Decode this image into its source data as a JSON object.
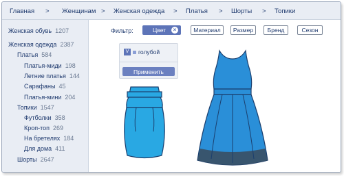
{
  "breadcrumb": {
    "items": [
      "Главная",
      "Женщинам",
      "Женская одежда",
      "Платья",
      "Шорты",
      "Топики"
    ],
    "separator": ">"
  },
  "sidebar": {
    "categories": [
      {
        "label": "Женская обувь",
        "count": "1207"
      },
      {
        "label": "Женская одежда",
        "count": "2387"
      },
      {
        "label": "Платья",
        "count": "584"
      },
      {
        "label": "Платья-миди",
        "count": "198"
      },
      {
        "label": "Летние платья",
        "count": "144"
      },
      {
        "label": "Сарафаны",
        "count": "45"
      },
      {
        "label": "Платья-мини",
        "count": "204"
      },
      {
        "label": "Топики",
        "count": "1547"
      },
      {
        "label": "Футболки",
        "count": "358"
      },
      {
        "label": "Кроп-топ",
        "count": "269"
      },
      {
        "label": "На бретелях",
        "count": "184"
      },
      {
        "label": "Для дома",
        "count": "411"
      },
      {
        "label": "Шорты",
        "count": "2647"
      }
    ]
  },
  "filter": {
    "label": "Фильтр:",
    "chips": [
      "Цвет",
      "Материал",
      "Размер",
      "Бренд",
      "Сезон"
    ],
    "active_chip": "Цвет",
    "close_glyph": "×"
  },
  "dropdown": {
    "check_glyph": "V",
    "option": "голубой",
    "apply_label": "Применить"
  },
  "products": [
    {
      "icon": "dress-icon",
      "color": "#29a8e3"
    },
    {
      "icon": "dress-icon",
      "color": "#2a8fd8"
    }
  ],
  "colors": {
    "accent": "#5d74b8",
    "dress_light": "#29a8e3",
    "dress_dark": "#2a8fd8"
  }
}
